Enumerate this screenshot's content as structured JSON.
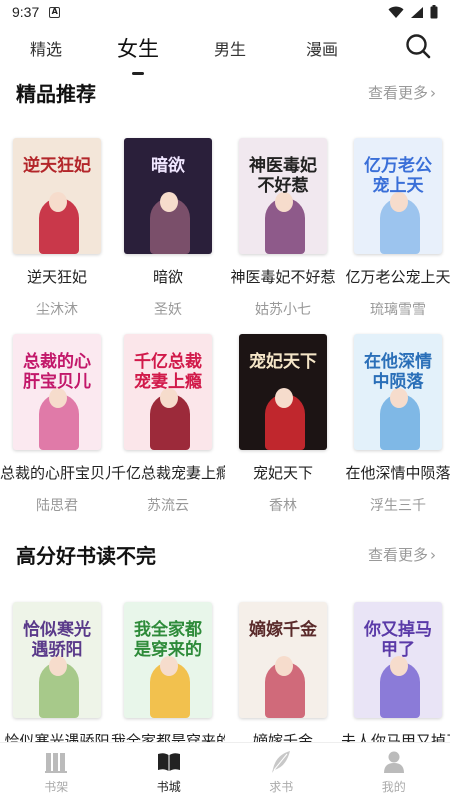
{
  "status_bar": {
    "time": "9:37",
    "notif_letter": "A"
  },
  "top_tabs": [
    {
      "label": "精选",
      "active": false
    },
    {
      "label": "女生",
      "active": true
    },
    {
      "label": "男生",
      "active": false
    },
    {
      "label": "漫画",
      "active": false
    }
  ],
  "sections": [
    {
      "title": "精品推荐",
      "more_label": "查看更多",
      "rows": [
        [
          {
            "name": "逆天狂妃",
            "author": "尘沐沐",
            "cover_text": "逆天狂妃",
            "bg": "#f3e6d9",
            "text_color": "#b3262a",
            "accent": "#c9384a"
          },
          {
            "name": "暗欲",
            "author": "圣妖",
            "cover_text": "暗欲",
            "bg": "#2a1f3a",
            "text_color": "#f0e6ff",
            "accent": "#7a4f6a"
          },
          {
            "name": "神医毒妃不好惹",
            "author": "姑苏小七",
            "cover_text": "神医毒妃不好惹",
            "bg": "#f1e8ef",
            "text_color": "#222222",
            "accent": "#8e5a8a"
          },
          {
            "name": "亿万老公宠上天",
            "author": "琉璃雪雪",
            "cover_text": "亿万老公宠上天",
            "bg": "#e8f0fb",
            "text_color": "#3a6fd8",
            "accent": "#9cc4ee"
          }
        ],
        [
          {
            "name": "总裁的心肝宝贝儿",
            "author": "陆思君",
            "cover_text": "总裁的心肝宝贝儿",
            "bg": "#fbe9f0",
            "text_color": "#c2186a",
            "accent": "#e07aa8"
          },
          {
            "name": "千亿总裁宠妻上瘾",
            "author": "苏流云",
            "cover_text": "千亿总裁宠妻上瘾",
            "bg": "#fbe6ea",
            "text_color": "#d11a4a",
            "accent": "#9c2a3a"
          },
          {
            "name": "宠妃天下",
            "author": "香林",
            "cover_text": "宠妃天下",
            "bg": "#1c1414",
            "text_color": "#f5e6c8",
            "accent": "#c0272d"
          },
          {
            "name": "在他深情中陨落",
            "author": "浮生三千",
            "cover_text": "在他深情中陨落",
            "bg": "#e3f1fa",
            "text_color": "#2a6fb8",
            "accent": "#7fb8e6"
          }
        ]
      ]
    },
    {
      "title": "高分好书读不完",
      "more_label": "查看更多",
      "rows": [
        [
          {
            "name": "恰似寒光遇骄阳",
            "author": "",
            "cover_text": "恰似寒光遇骄阳",
            "bg": "#eef4e8",
            "text_color": "#5a3a8a",
            "accent": "#a7c98a"
          },
          {
            "name": "我全家都是穿来的",
            "author": "",
            "cover_text": "我全家都是穿来的",
            "bg": "#e8f6ea",
            "text_color": "#2e8b3a",
            "accent": "#f2c14e"
          },
          {
            "name": "嫡嫁千金",
            "author": "",
            "cover_text": "嫡嫁千金",
            "bg": "#f5efe9",
            "text_color": "#5a2a2a",
            "accent": "#d06a7a"
          },
          {
            "name": "夫人你马甲又掉了",
            "author": "",
            "cover_text": "你又掉马甲了",
            "bg": "#e9e4f6",
            "text_color": "#5a3aa8",
            "accent": "#8b7bd8"
          }
        ]
      ]
    }
  ],
  "bottom_nav": [
    {
      "label": "书架",
      "icon": "bookshelf-icon",
      "active": false
    },
    {
      "label": "书城",
      "icon": "open-book-icon",
      "active": true
    },
    {
      "label": "求书",
      "icon": "feather-icon",
      "active": false
    },
    {
      "label": "我的",
      "icon": "person-icon",
      "active": false
    }
  ]
}
